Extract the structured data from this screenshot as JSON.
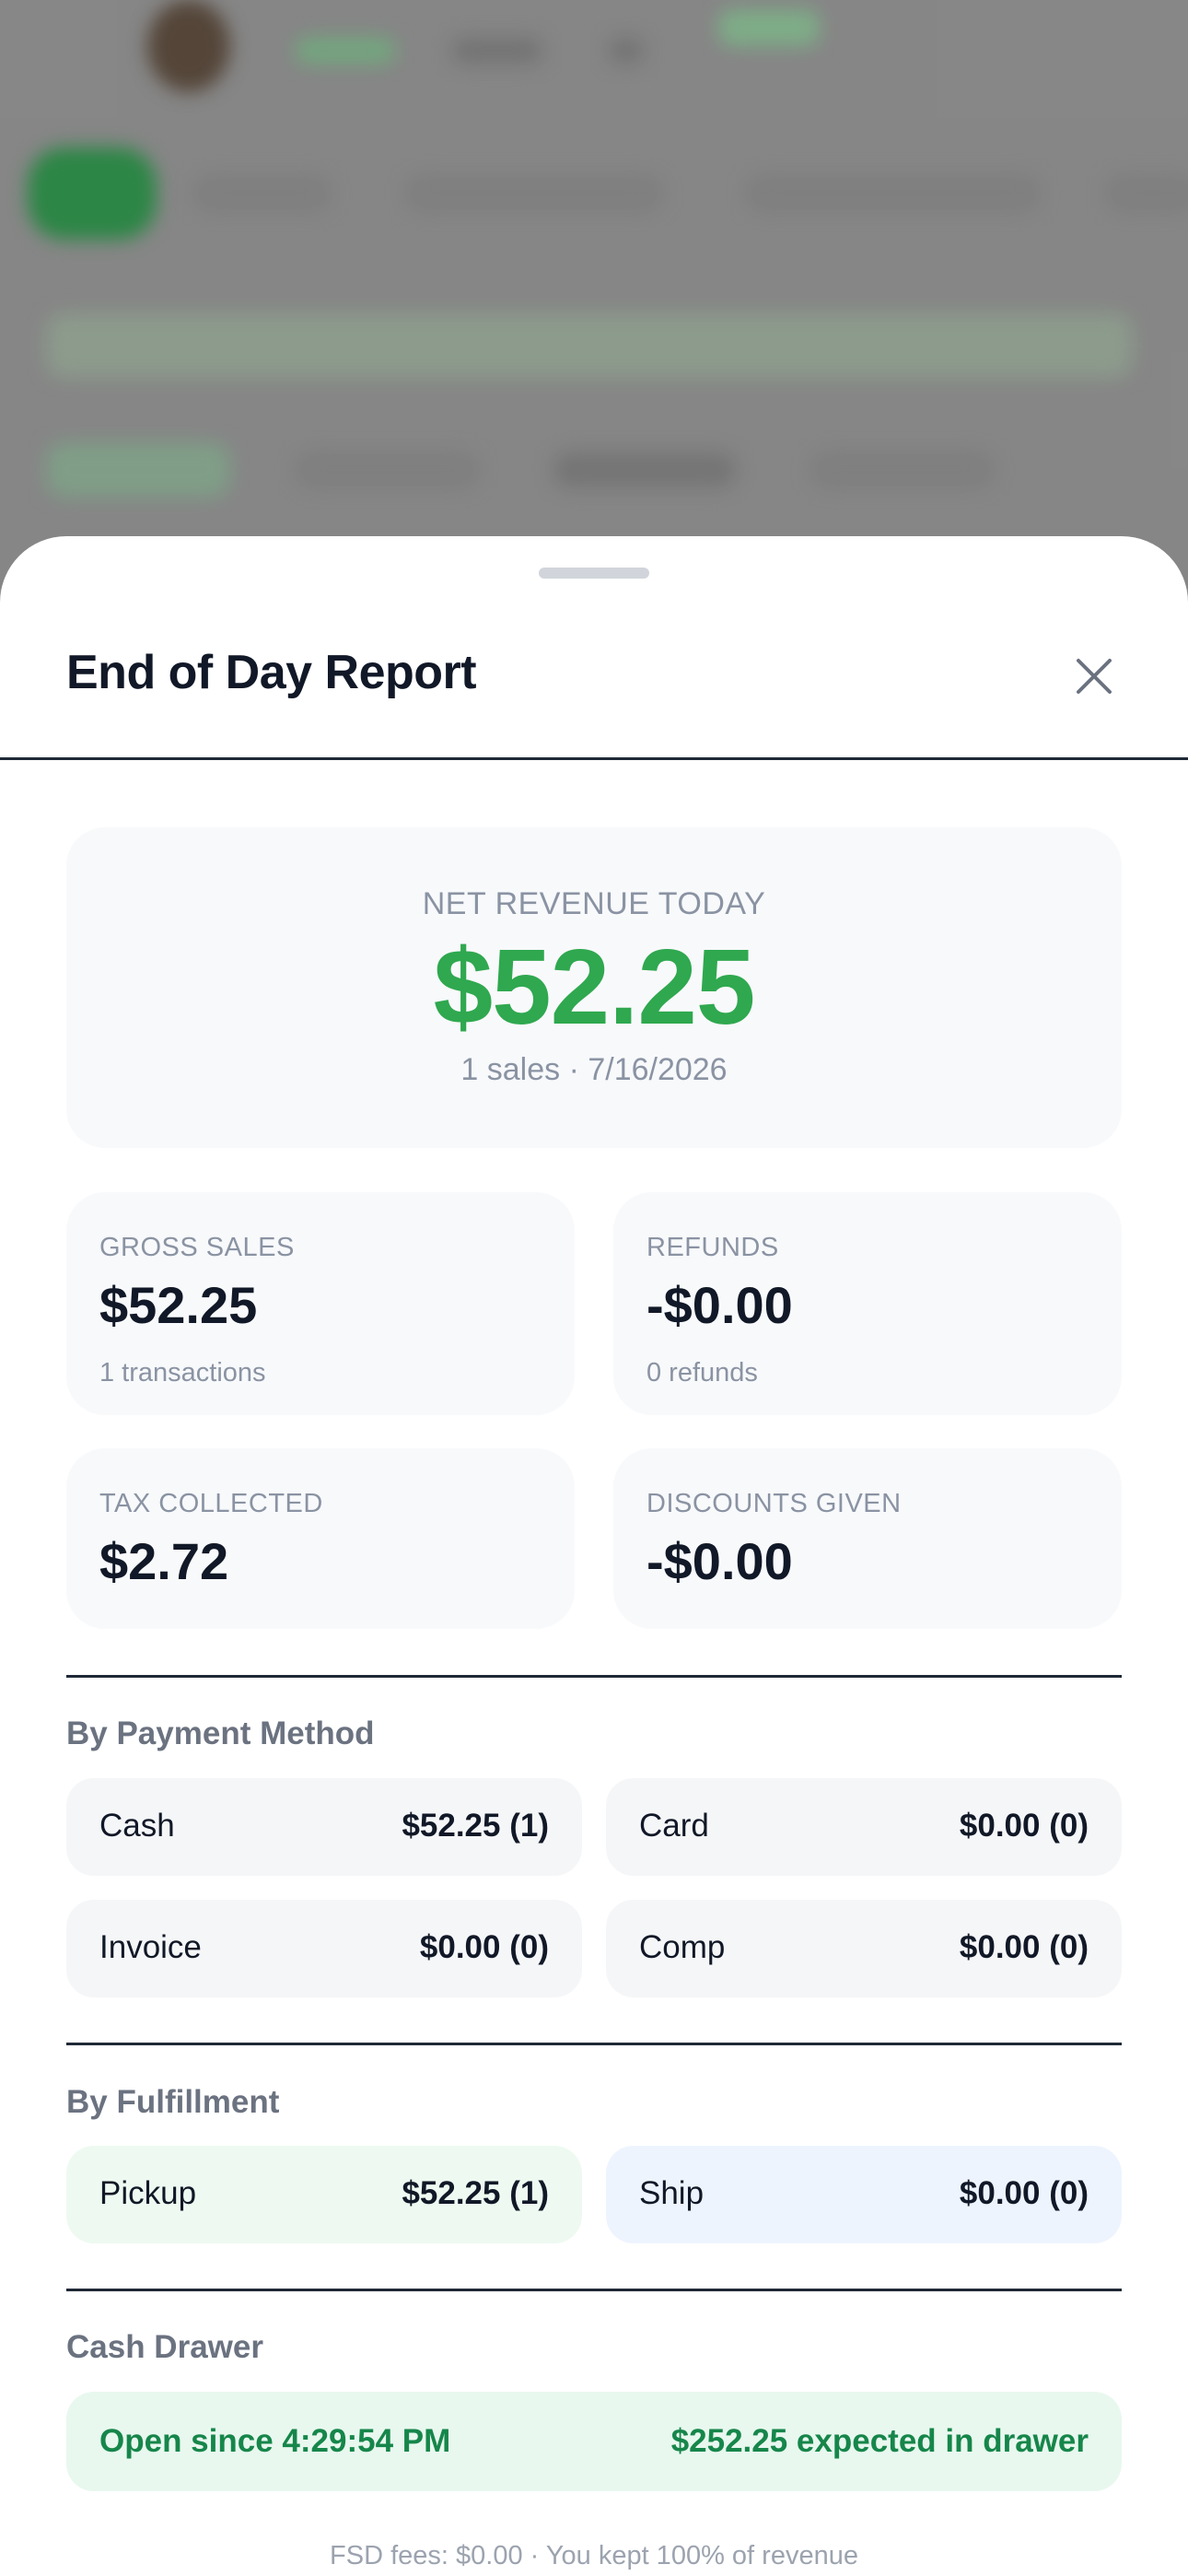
{
  "colors": {
    "accent_green": "#2fa84f",
    "pickup_bg": "#eefaf1",
    "ship_bg": "#eef4fe",
    "drawer_bg": "#e8f8ef",
    "drawer_text": "#16864a"
  },
  "sheet": {
    "title": "End of Day Report",
    "close_icon": "close-icon"
  },
  "net_revenue": {
    "label": "NET REVENUE TODAY",
    "value": "$52.25",
    "meta": "1 sales · 7/16/2026"
  },
  "stats": [
    {
      "label": "GROSS SALES",
      "value": "$52.25",
      "sub": "1 transactions"
    },
    {
      "label": "REFUNDS",
      "value": "-$0.00",
      "sub": "0 refunds"
    },
    {
      "label": "TAX COLLECTED",
      "value": "$2.72",
      "sub": ""
    },
    {
      "label": "DISCOUNTS GIVEN",
      "value": "-$0.00",
      "sub": ""
    }
  ],
  "payment_methods": {
    "title": "By Payment Method",
    "items": [
      {
        "label": "Cash",
        "value": "$52.25 (1)"
      },
      {
        "label": "Card",
        "value": "$0.00 (0)"
      },
      {
        "label": "Invoice",
        "value": "$0.00 (0)"
      },
      {
        "label": "Comp",
        "value": "$0.00 (0)"
      }
    ]
  },
  "fulfillment": {
    "title": "By Fulfillment",
    "items": [
      {
        "label": "Pickup",
        "value": "$52.25 (1)"
      },
      {
        "label": "Ship",
        "value": "$0.00 (0)"
      }
    ]
  },
  "cash_drawer": {
    "title": "Cash Drawer",
    "open_since": "Open since 4:29:54 PM",
    "expected": "$252.25 expected in drawer"
  },
  "footer_note": "FSD fees: $0.00 · You kept 100% of revenue"
}
